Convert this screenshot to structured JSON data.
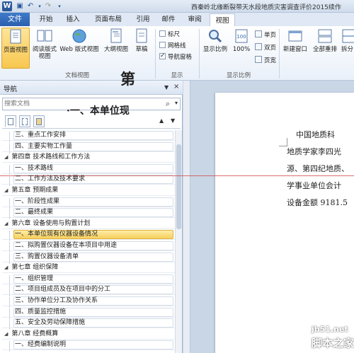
{
  "window": {
    "app_letter": "W",
    "title": "西秦岭北缘断裂带天水段地质灾害调查评价2015续作"
  },
  "ribbon_tabs": {
    "file": "文件",
    "items": [
      "开始",
      "插入",
      "页面布局",
      "引用",
      "邮件",
      "审阅",
      "视图"
    ],
    "active": "视图"
  },
  "ribbon": {
    "views": {
      "print_layout": "页面视图",
      "reading_line1": "阅读版式",
      "reading_line2": "视图",
      "web": "Web 版式视图",
      "outline": "大纲视图",
      "draft": "草稿",
      "group_label": "文档视图"
    },
    "show": {
      "ruler": "标尺",
      "gridlines": "网格线",
      "nav_pane": "导航窗格",
      "group_label": "显示"
    },
    "zoom": {
      "zoom": "显示比例",
      "hundred": "100%",
      "one_page": "单页",
      "two_pages": "双页",
      "page_width": "页宽",
      "group_label": "显示比例"
    },
    "window": {
      "new_window": "新建窗口",
      "arrange_all": "全部重排",
      "split": "拆分"
    }
  },
  "nav": {
    "title": "导航",
    "close": "×",
    "dropdown": "▼",
    "search_placeholder": "搜索文档",
    "up": "▲",
    "down": "▼",
    "items": [
      {
        "text": "三、重点工作安排",
        "level": 2
      },
      {
        "text": "四、主要实物工作量",
        "level": 2
      },
      {
        "text": "第四章 技术路线和工作方法",
        "level": 1
      },
      {
        "text": "一、技术路线",
        "level": 2
      },
      {
        "text": "二、工作方法及技术要求",
        "level": 2
      },
      {
        "text": "第五章 预期成果",
        "level": 1
      },
      {
        "text": "一、阶段性成果",
        "level": 2
      },
      {
        "text": "二、最终成果",
        "level": 2
      },
      {
        "text": "第六章 设备使用与购置计划",
        "level": 1
      },
      {
        "text": "一、本单位现有仪器设备情况",
        "level": 2,
        "selected": true
      },
      {
        "text": "二、拟购置仪器设备在本项目中用途",
        "level": 2
      },
      {
        "text": "三、购置仪器设备清单",
        "level": 2
      },
      {
        "text": "第七章 组织保障",
        "level": 1
      },
      {
        "text": "一、组织管理",
        "level": 2
      },
      {
        "text": "二、项目组成员及在项目中的分工",
        "level": 2
      },
      {
        "text": "三、协作单位分工及协作关系",
        "level": 2
      },
      {
        "text": "四、质量监控措施",
        "level": 2
      },
      {
        "text": "五、安全及劳动保障措施",
        "level": 2
      },
      {
        "text": "第八章 经费概算",
        "level": 1
      },
      {
        "text": "一、经费编制说明",
        "level": 2
      }
    ]
  },
  "document": {
    "chapter_partial": "第",
    "heading": "·一、本单位现",
    "lines": [
      "中国地质科",
      "地质学家李四光",
      "源、第四纪地质、",
      "学事业单位会计",
      "设备金额 9181.5"
    ]
  },
  "watermark": {
    "site": "jb51.net",
    "name": "脚本之家"
  }
}
